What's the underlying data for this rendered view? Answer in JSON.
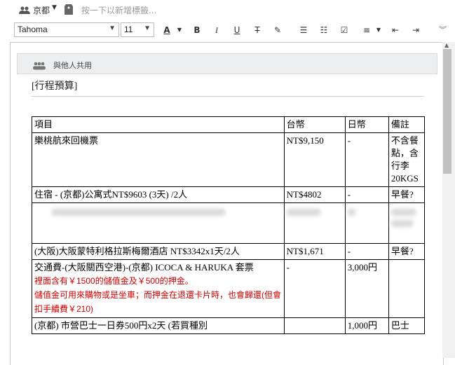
{
  "topbar": {
    "notebook": "京都",
    "tag_placeholder": "按一下以新增標籤..."
  },
  "toolbar": {
    "font": "Tahoma",
    "size": "11"
  },
  "share": {
    "label": "與他人共用"
  },
  "note": {
    "heading": "[行程預算]",
    "columns": [
      "項目",
      "台幣",
      "日幣",
      "備註"
    ],
    "rows": [
      {
        "item": "樂桃航來回機票",
        "twd": "NT$9,150",
        "jpy": "-",
        "note": "不含餐點，含行李20KGS"
      },
      {
        "item": "住宿 - (京都)公寓式NT$9603 (3天) /2人",
        "twd": "NT$4802",
        "jpy": "-",
        "note": "早餐?"
      },
      {
        "item": "",
        "twd": "",
        "jpy": "",
        "note": ""
      },
      {
        "item": "(大阪)大阪蒙特利格拉斯梅爾酒店 NT$3342x1天/2人",
        "twd": "NT$1,671",
        "jpy": "-",
        "note": "早餐?"
      },
      {
        "item": "交通費-(大阪關西空港)-(京都)  ICOCA & HARUKA 套票",
        "twd": "-",
        "jpy": "3,000円",
        "note": "",
        "red_lines": [
          "裡面含有￥1500的儲值金及￥500的押金。",
          "儲值金可用來購物或是坐車；而押金在退還卡片時，也會歸還(但會扣手續費￥210)"
        ]
      },
      {
        "item": "(京都) 市營巴士一日券500円x2天 (若買種別",
        "twd": "",
        "jpy": "1,000円",
        "note": "巴士"
      }
    ]
  }
}
